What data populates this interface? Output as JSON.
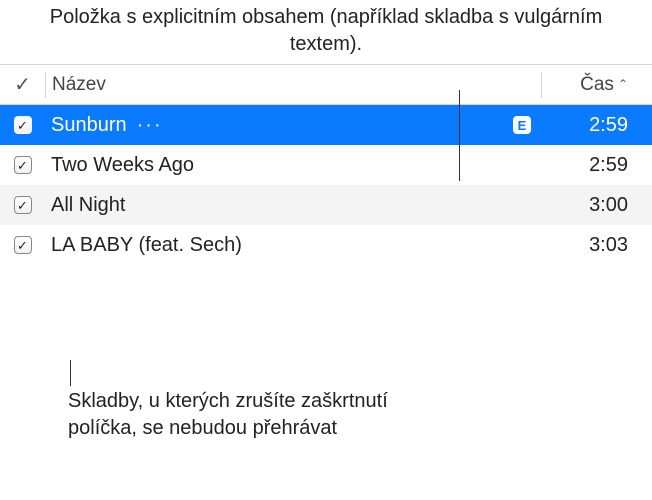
{
  "callouts": {
    "top": "Položka s explicitním obsahem (například skladba s vulgárním textem).",
    "bottom": "Skladby, u kterých zrušíte zaškrtnutí políčka, se nebudou přehrávat"
  },
  "table": {
    "headers": {
      "name": "Název",
      "time": "Čas"
    },
    "sort_ascending": true,
    "rows": [
      {
        "checked": true,
        "name": "Sunburn",
        "menu": true,
        "explicit": true,
        "time": "2:59",
        "selected": true
      },
      {
        "checked": true,
        "name": "Two Weeks Ago",
        "menu": false,
        "explicit": false,
        "time": "2:59",
        "selected": false
      },
      {
        "checked": true,
        "name": "All Night",
        "menu": false,
        "explicit": false,
        "time": "3:00",
        "selected": false
      },
      {
        "checked": true,
        "name": "LA BABY (feat. Sech)",
        "menu": false,
        "explicit": false,
        "time": "3:03",
        "selected": false
      }
    ]
  },
  "glyphs": {
    "check": "✓",
    "ellipsis": "···",
    "explicit": "E",
    "sort_up": "⌃"
  }
}
